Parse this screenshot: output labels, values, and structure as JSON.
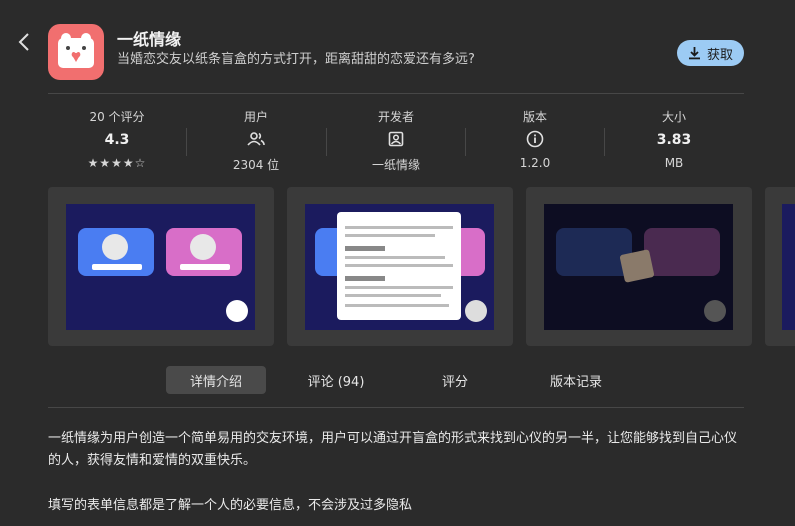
{
  "header": {
    "app_name": "一纸情缘",
    "app_desc": "当婚恋交友以纸条盲盒的方式打开，距离甜甜的恋爱还有多远?",
    "get_label": "获取",
    "accent": "#9ccbf4",
    "icon_color": "#f16f6f"
  },
  "stats": {
    "rating_label": "20 个评分",
    "rating_value": "4.3",
    "rating_stars": "★★★★☆",
    "users_label": "用户",
    "users_value": "2304 位",
    "developer_label": "开发者",
    "developer_value": "一纸情缘",
    "version_label": "版本",
    "version_value": "1.2.0",
    "size_label": "大小",
    "size_value": "3.83",
    "size_unit": "MB"
  },
  "tabs": {
    "details": "详情介绍",
    "reviews": "评论 (94)",
    "ratings": "评分",
    "history": "版本记录"
  },
  "description": {
    "p1": "一纸情缘为用户创造一个简单易用的交友环境，用户可以通过开盲盒的形式来找到心仪的另一半，让您能够找到自己心仪的人，获得友情和爱情的双重快乐。",
    "p2": "填写的表单信息都是了解一个人的必要信息，不会涉及过多隐私"
  }
}
